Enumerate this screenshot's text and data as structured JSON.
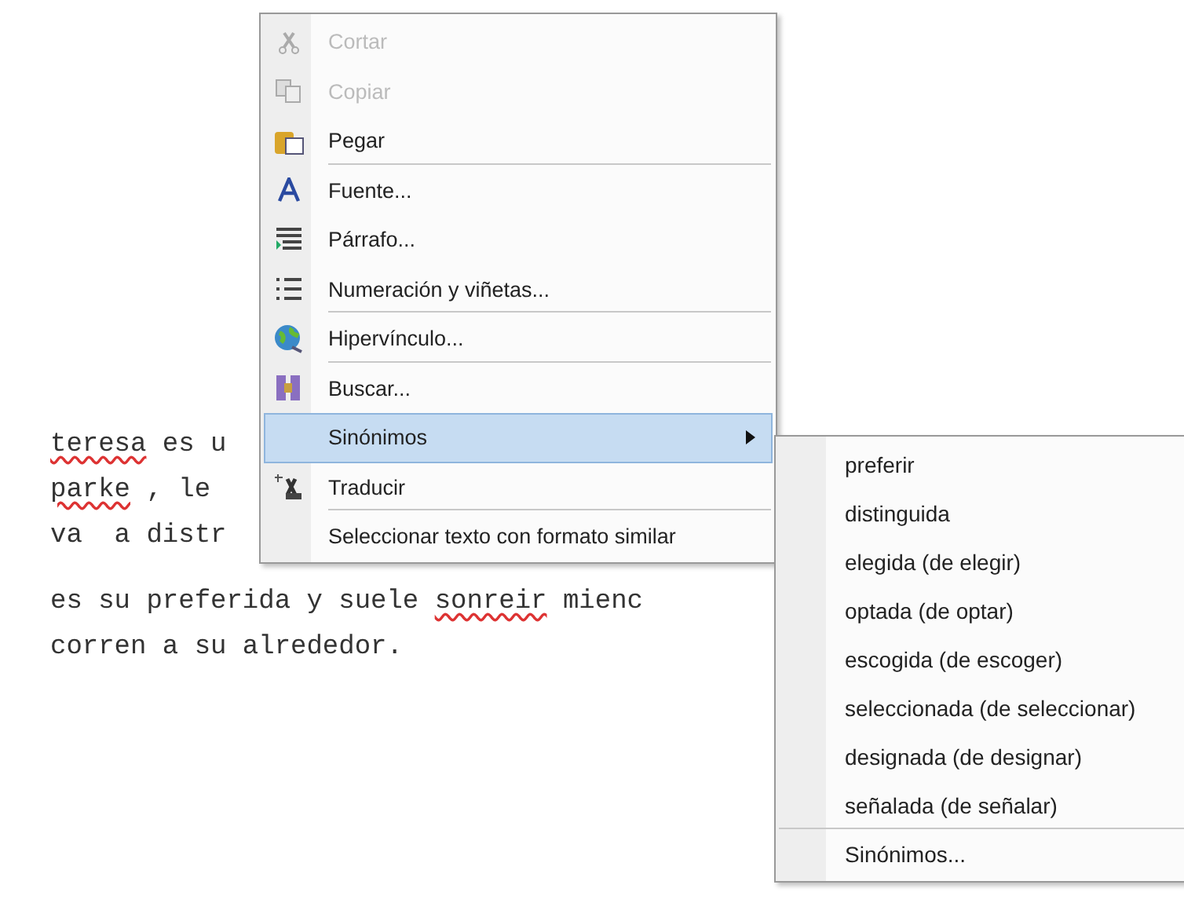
{
  "document": {
    "lines": [
      {
        "segments": [
          {
            "text": "teresa",
            "misspelled": true
          },
          {
            "text": " es u",
            "misspelled": false
          }
        ]
      },
      {
        "segments": [
          {
            "text": "parke",
            "misspelled": true
          },
          {
            "text": " , le",
            "misspelled": false
          }
        ]
      },
      {
        "segments": [
          {
            "text": "va  a distr",
            "misspelled": false
          }
        ]
      },
      {
        "segments": [
          {
            "text": "es su preferida y suele ",
            "misspelled": false
          },
          {
            "text": "sonreir",
            "misspelled": true
          },
          {
            "text": " mienc",
            "misspelled": false
          }
        ]
      },
      {
        "segments": [
          {
            "text": "corren a su alrededor.",
            "misspelled": false
          }
        ]
      }
    ]
  },
  "context_menu": {
    "items": [
      {
        "label": "Cortar",
        "disabled": true,
        "selected": false,
        "submenu": false,
        "separator_after": false
      },
      {
        "label": "Copiar",
        "disabled": true,
        "selected": false,
        "submenu": false,
        "separator_after": false
      },
      {
        "label": "Pegar",
        "disabled": false,
        "selected": false,
        "submenu": false,
        "separator_after": true
      },
      {
        "label": "Fuente...",
        "disabled": false,
        "selected": false,
        "submenu": false,
        "separator_after": false
      },
      {
        "label": "Párrafo...",
        "disabled": false,
        "selected": false,
        "submenu": false,
        "separator_after": false
      },
      {
        "label": "Numeración y viñetas...",
        "disabled": false,
        "selected": false,
        "submenu": false,
        "separator_after": true
      },
      {
        "label": "Hipervínculo...",
        "disabled": false,
        "selected": false,
        "submenu": false,
        "separator_after": true
      },
      {
        "label": "Buscar...",
        "disabled": false,
        "selected": false,
        "submenu": false,
        "separator_after": false
      },
      {
        "label": "Sinónimos",
        "disabled": false,
        "selected": true,
        "submenu": true,
        "separator_after": false
      },
      {
        "label": "Traducir",
        "disabled": false,
        "selected": false,
        "submenu": false,
        "separator_after": true
      },
      {
        "label": "Seleccionar texto con formato similar",
        "disabled": false,
        "selected": false,
        "submenu": false,
        "separator_after": false
      }
    ]
  },
  "synonyms_menu": {
    "items": [
      {
        "label": "preferir",
        "separator_after": false
      },
      {
        "label": "distinguida",
        "separator_after": false
      },
      {
        "label": "elegida (de elegir)",
        "separator_after": false
      },
      {
        "label": "optada (de optar)",
        "separator_after": false
      },
      {
        "label": "escogida (de escoger)",
        "separator_after": false
      },
      {
        "label": "seleccionada (de seleccionar)",
        "separator_after": false
      },
      {
        "label": "designada (de designar)",
        "separator_after": false
      },
      {
        "label": "señalada (de señalar)",
        "separator_after": true
      },
      {
        "label": "Sinónimos...",
        "separator_after": false
      }
    ]
  }
}
